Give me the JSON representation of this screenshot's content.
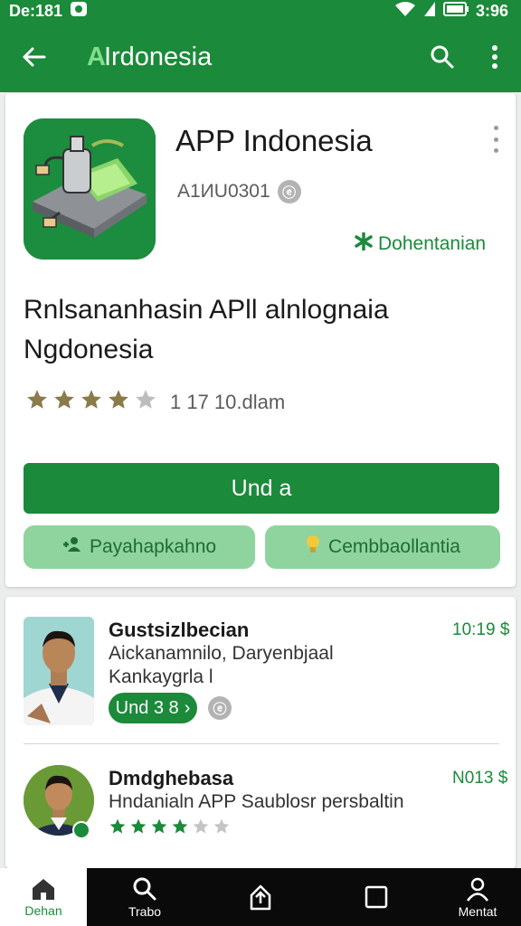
{
  "status": {
    "time": "De:181",
    "battery": "3:96"
  },
  "appbar": {
    "title_prefix": "A",
    "title": "Irdonesia"
  },
  "app": {
    "name": "APP Indonesia",
    "id": "A1ИU0301",
    "badge": "Dohentanian",
    "description": "Rnlsananhasin APll alnlognaia Ngdonesia",
    "rating": 4,
    "rating_max": 5,
    "rating_count": "1 17 10.dlam",
    "primary_button": "Und a",
    "secondary_left": "Payahapkahno",
    "secondary_right": "Cembbaollantia"
  },
  "reviews": [
    {
      "name": "Gustsizlbecian",
      "time": "10:19 $",
      "line1": "Aickanamnilo, Daryenbjaal",
      "line2": "Kankaygrla l",
      "button": "Und 3 8"
    },
    {
      "name": "Dmdghebasa",
      "time": "N013 $",
      "line1": "Hndanialn APP Saublosr persbaltin",
      "rating": 4,
      "rating_max": 6
    }
  ],
  "bottom_nav": [
    {
      "label": "Dehan",
      "icon": "home-icon"
    },
    {
      "label": "Trabo",
      "icon": "search-icon"
    },
    {
      "label": "",
      "icon": "upload-icon"
    },
    {
      "label": "",
      "icon": "square-icon"
    },
    {
      "label": "Mentat",
      "icon": "profile-icon"
    }
  ],
  "colors": {
    "primary": "#1b8a3a",
    "pill": "#8fd49e",
    "star_gold": "#8a7b4b",
    "star_green": "#1b8a3a"
  }
}
